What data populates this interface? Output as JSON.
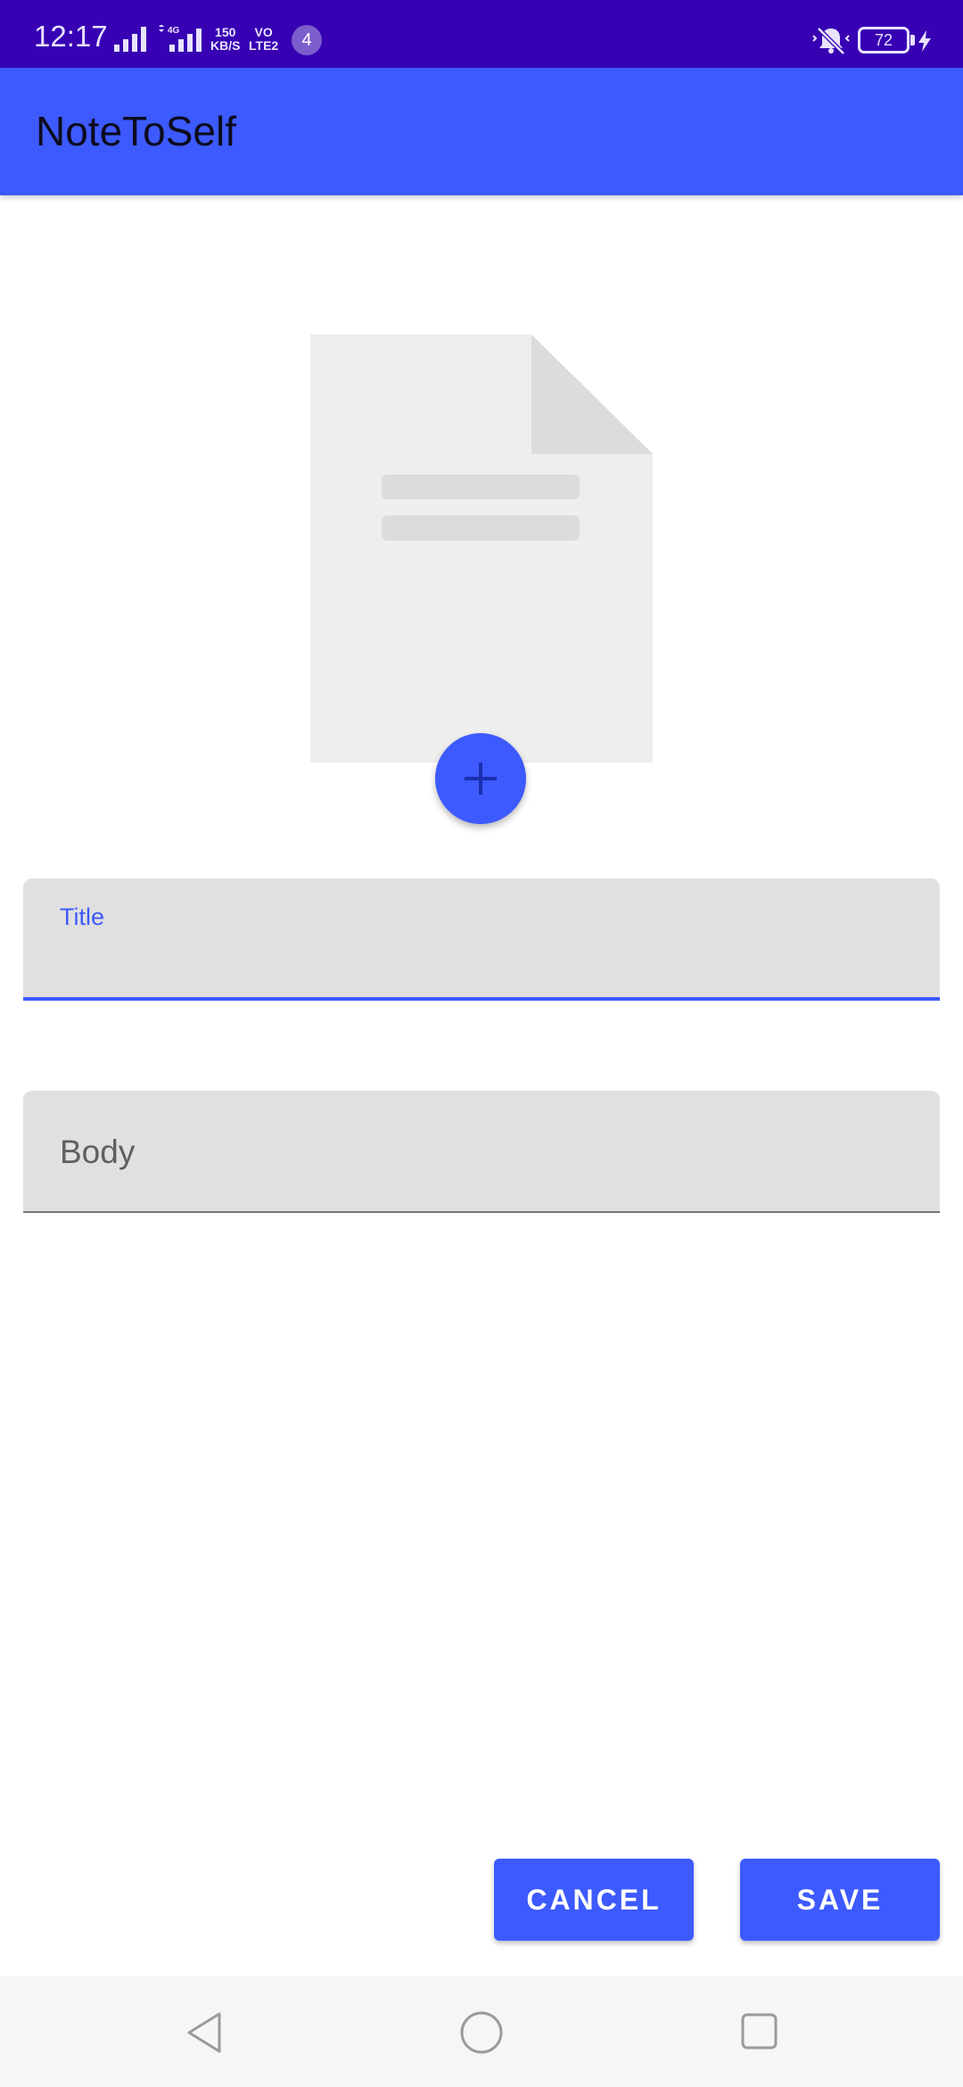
{
  "status_bar": {
    "time": "12:17",
    "speed_value": "150",
    "speed_unit": "KB/S",
    "volte_top": "VO",
    "volte_bottom": "LTE2",
    "network_label": "4G",
    "notification_count": "4",
    "battery_level": "72",
    "icons": [
      "signal-icon",
      "signal-4g-icon",
      "mute-icon",
      "battery-icon",
      "charging-icon"
    ]
  },
  "app_bar": {
    "title": "NoteToSelf"
  },
  "image_placeholder": {
    "icon": "document-placeholder-icon",
    "add_button_icon": "plus-icon"
  },
  "form": {
    "title_label": "Title",
    "title_value": "",
    "body_label": "Body",
    "body_value": ""
  },
  "actions": {
    "cancel_label": "CANCEL",
    "save_label": "SAVE"
  },
  "nav_bar": {
    "icons": [
      "back-icon",
      "home-icon",
      "recents-icon"
    ]
  },
  "colors": {
    "status_bar": "#3700b3",
    "accent": "#3d5afe",
    "field_background": "#e0e0e0"
  }
}
